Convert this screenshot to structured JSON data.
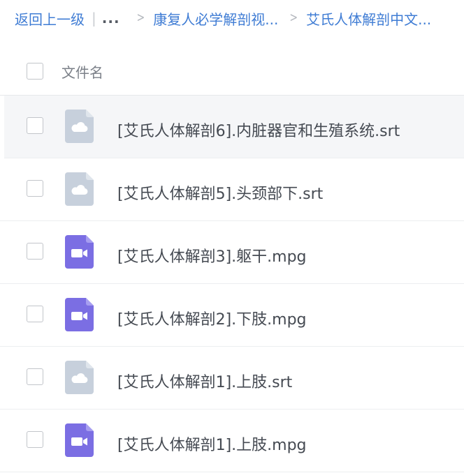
{
  "breadcrumb": {
    "back_label": "返回上一级",
    "ellipsis": "...",
    "separator_char": "|",
    "chevron_char": ">",
    "path": [
      "康复人必学解剖视...",
      "艾氏人体解剖中文..."
    ]
  },
  "header": {
    "column_name": "文件名"
  },
  "files": [
    {
      "name": "[艾氏人体解剖6].内脏器官和生殖系统.srt",
      "type": "subtitle",
      "icon": "cloud-file-icon"
    },
    {
      "name": "[艾氏人体解剖5].头颈部下.srt",
      "type": "subtitle",
      "icon": "cloud-file-icon"
    },
    {
      "name": "[艾氏人体解剖3].躯干.mpg",
      "type": "video",
      "icon": "video-file-icon"
    },
    {
      "name": "[艾氏人体解剖2].下肢.mpg",
      "type": "video",
      "icon": "video-file-icon"
    },
    {
      "name": "[艾氏人体解剖1].上肢.srt",
      "type": "subtitle",
      "icon": "cloud-file-icon"
    },
    {
      "name": "[艾氏人体解剖1].上肢.mpg",
      "type": "video",
      "icon": "video-file-icon"
    }
  ],
  "colors": {
    "link": "#3f7cd4",
    "text": "#454a52",
    "muted_text": "#7b8088",
    "subtitle_icon": "#c7d0dc",
    "video_icon": "#7b6ee3",
    "hover_row": "#f5f6f8"
  }
}
